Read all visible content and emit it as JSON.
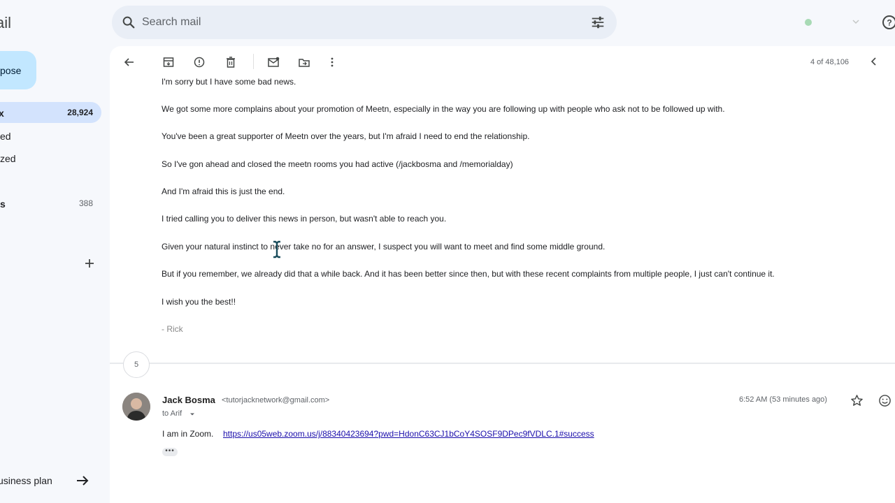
{
  "app": {
    "title": "ail"
  },
  "search": {
    "placeholder": "Search mail"
  },
  "sidebar": {
    "compose_label": "pose",
    "items": [
      {
        "label": "x",
        "count": "28,924"
      },
      {
        "label": "ed",
        "count": ""
      },
      {
        "label": "zed",
        "count": ""
      },
      {
        "label": "s",
        "count": "388"
      }
    ],
    "upgrade_label": "usiness plan"
  },
  "toolbar": {
    "pager": "4 of 48,106"
  },
  "message": {
    "paragraphs": [
      "I'm sorry but I have some bad news.",
      "We got some more complains about your promotion of Meetn, especially in the way you are following up with people who ask not to be followed up with.",
      "You've been a great supporter of Meetn over the years, but I'm afraid I need to end the relationship.",
      "So I've gon ahead and closed the meetn rooms you had active (/jackbosma and /memorialday)",
      "And I'm afraid this is just the end.",
      "I tried calling you to deliver this news in person, but wasn't able to reach you.",
      "Given your natural instinct to never take no for an answer, I suspect you will want to meet and find some middle ground.",
      "But if you remember, we already did that a while back.  And it has been better since then, but with these recent complaints from multiple people, I just can't continue it.",
      "I wish you the best!!"
    ],
    "signature": "- Rick"
  },
  "collapsed": {
    "count": "5"
  },
  "reply": {
    "sender_name": "Jack Bosma",
    "sender_email": "<tutorjacknetwork@gmail.com>",
    "to": "to Arif",
    "time": "6:52 AM (53 minutes ago)",
    "body": "I am in Zoom.",
    "link": "https://us05web.zoom.us/j/88340423694?pwd=HdonC63CJ1bCoY4SOSF9DPec9fVDLC.1#success",
    "ellipsis": "•••"
  }
}
